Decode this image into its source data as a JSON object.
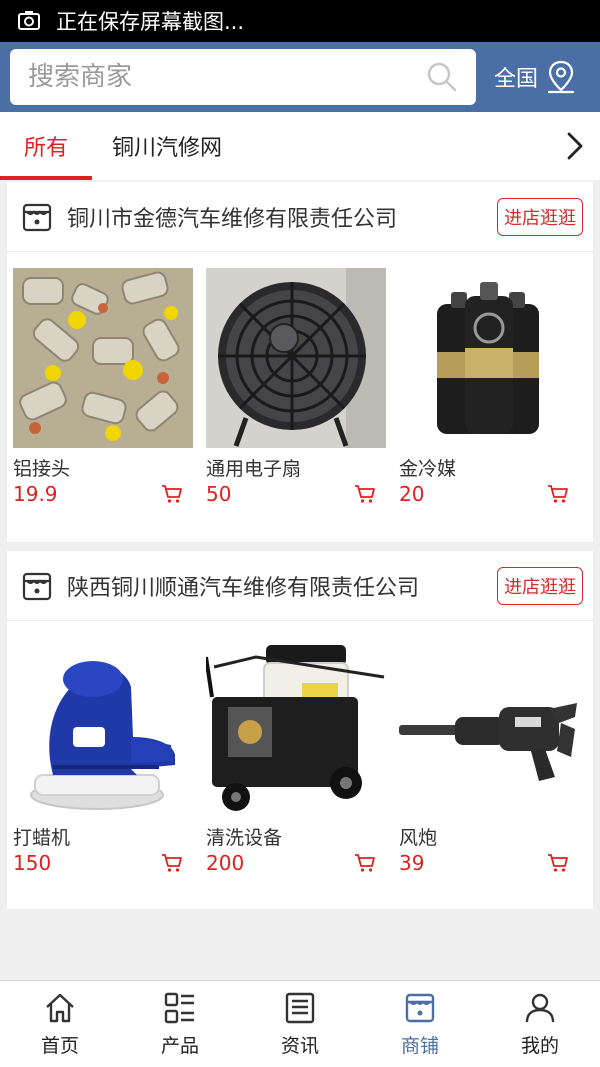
{
  "status_bar": {
    "text": "正在保存屏幕截图...",
    "icon": "screenshot-icon"
  },
  "search": {
    "placeholder": "搜索商家",
    "region_label": "全国"
  },
  "tabs": [
    {
      "label": "所有",
      "active": true
    },
    {
      "label": "铜川汽修网",
      "active": false
    }
  ],
  "shops": [
    {
      "name": "铜川市金德汽车维修有限责任公司",
      "visit_label": "进店逛逛",
      "products": [
        {
          "name": "铝接头",
          "price": "19.9"
        },
        {
          "name": "通用电子扇",
          "price": "50"
        },
        {
          "name": "金冷媒",
          "price": "20"
        }
      ]
    },
    {
      "name": "陕西铜川顺通汽车维修有限责任公司",
      "visit_label": "进店逛逛",
      "products": [
        {
          "name": "打蜡机",
          "price": "150"
        },
        {
          "name": "清洗设备",
          "price": "200"
        },
        {
          "name": "风炮",
          "price": "39"
        }
      ]
    }
  ],
  "bottom_nav": [
    {
      "label": "首页",
      "icon": "home-icon",
      "active": false
    },
    {
      "label": "产品",
      "icon": "list-icon",
      "active": false
    },
    {
      "label": "资讯",
      "icon": "news-icon",
      "active": false
    },
    {
      "label": "商铺",
      "icon": "store-icon",
      "active": true
    },
    {
      "label": "我的",
      "icon": "user-icon",
      "active": false
    }
  ],
  "colors": {
    "brand": "#4a6fa5",
    "accent": "#e02020",
    "background": "#efefef"
  }
}
